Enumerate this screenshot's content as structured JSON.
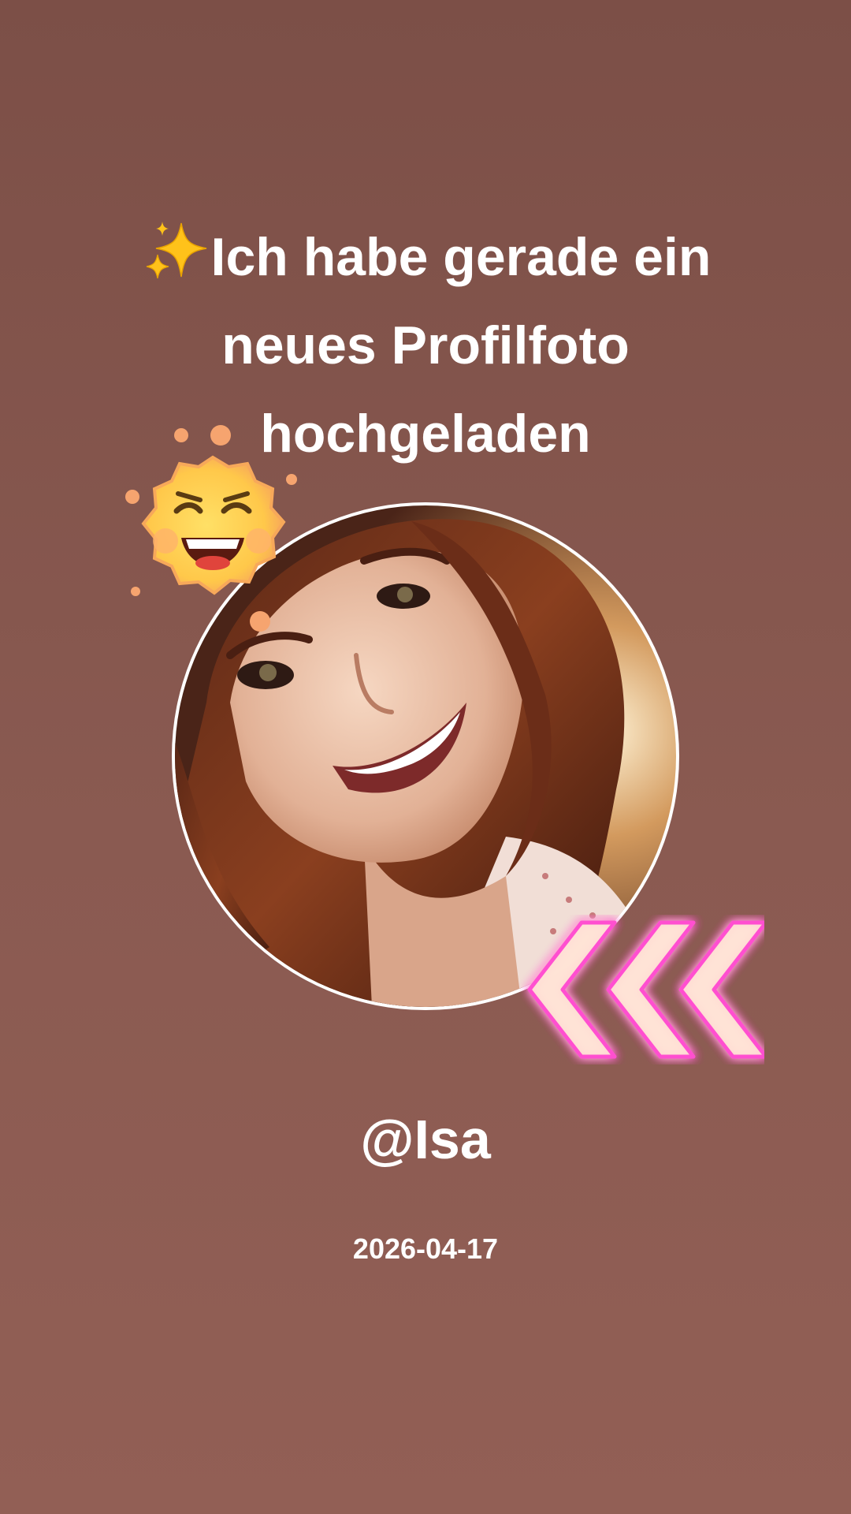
{
  "post": {
    "headline_lines": [
      "Ich habe gerade ein",
      "neues Profilfoto",
      "hochgeladen"
    ],
    "username": "@Isa",
    "date": "2026-04-17"
  },
  "stickers": {
    "title_icon": "sparkles-icon",
    "sun": "laughing-sun-sticker-icon",
    "arrows": "neon-chevrons-left-icon"
  },
  "colors": {
    "background": "#7c4f47",
    "text": "#ffffff",
    "neon": "#ff5fd2"
  }
}
